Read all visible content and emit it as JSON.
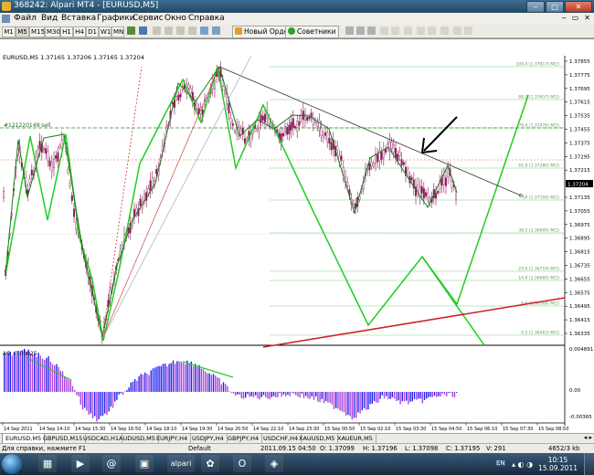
{
  "window": {
    "title": "368242: Alpari MT4 - [EURUSD,M5]",
    "controls": [
      "‒",
      "□",
      "✕"
    ]
  },
  "menu": {
    "items": [
      "Файл",
      "Вид",
      "Вставка",
      "Графики",
      "Сервис",
      "Окно",
      "Справка"
    ],
    "mdi_controls": [
      "‒",
      "▭",
      "✕"
    ]
  },
  "toolbar": {
    "timeframes": [
      "M1",
      "M5",
      "M15",
      "M30",
      "H1",
      "H4",
      "D1",
      "W1",
      "MN"
    ],
    "active_timeframe": "M5",
    "new_order_label": "Новый Ордер",
    "advisors_label": "Советники"
  },
  "chart": {
    "symbol_label": "EURUSD,M5  1.37165 1.37206 1.37165 1.37204",
    "left_label": "#121220149 sell",
    "price_scale": [
      "1.37855",
      "1.37775",
      "1.37695",
      "1.37615",
      "1.37535",
      "1.37455",
      "1.37375",
      "1.37295",
      "1.37215",
      "1.37204",
      "1.37135",
      "1.37055",
      "1.36975",
      "1.36895",
      "1.36815",
      "1.36735",
      "1.36655",
      "1.36575",
      "1.36495",
      "1.36415",
      "1.36335"
    ],
    "current_price": "1.37204",
    "fib_labels": [
      "100.0 (1.37817) M15",
      "88.2 (1.37637) M15",
      "76.4 (1.37476) M15",
      "61.8 (1.37280) M15",
      "50 (1.37100) M15",
      "38.2 (1.36900) M15",
      "23.6 (1.36719) M15",
      "14.6 (1.36680) M15",
      "6.8 (1.36568) M15",
      "0.2 (1.36363) M15"
    ],
    "time_axis": [
      "14 Sep 2011",
      "14 Sep 14:10",
      "14 Sep 15:30",
      "14 Sep 16:50",
      "14 Sep 18:10",
      "14 Sep 19:30",
      "14 Sep 20:50",
      "14 Sep 22:10",
      "14 Sep 23:30",
      "15 Sep 00:50",
      "15 Sep 02:10",
      "15 Sep 03:30",
      "15 Sep 04:50",
      "15 Sep 06:10",
      "15 Sep 07:30",
      "15 Sep 08:50"
    ],
    "ao_label": "AO -0.00025",
    "ao_scale": [
      "0.004891",
      "0.00",
      "-0.00365"
    ]
  },
  "tabs": {
    "items": [
      "EURUSD,M5",
      "GBPUSD,M15",
      "USDCAD,H1",
      "AUDUSD,M5",
      "EURJPY,H4",
      "USDJPY,H4",
      "GBPJPY,H4",
      "USDCHF,H4",
      "XAUUSD,M5",
      "XAUEUR,M5"
    ],
    "active": "EURUSD,M5"
  },
  "status": {
    "help": "Для справки, нажмите F1",
    "profile": "Default",
    "datetime": "2011.09.15 04:50",
    "open": "O: 1.37099",
    "high": "H: 1.37196",
    "low": "L: 1.37098",
    "close": "C: 1.37195",
    "volume": "V: 291",
    "traffic": "4652/3 kb"
  },
  "taskbar": {
    "lang": "EN",
    "time": "10:15",
    "date": "15.09.2011"
  },
  "colors": {
    "zigzag": "#22cc22",
    "fibonacci": "#7fcf7f",
    "trendline": "#cc2222",
    "ao_up": "#2222ee",
    "ao_down": "#aa44dd",
    "candle": "#8a1a5a",
    "arrow": "#000000"
  }
}
